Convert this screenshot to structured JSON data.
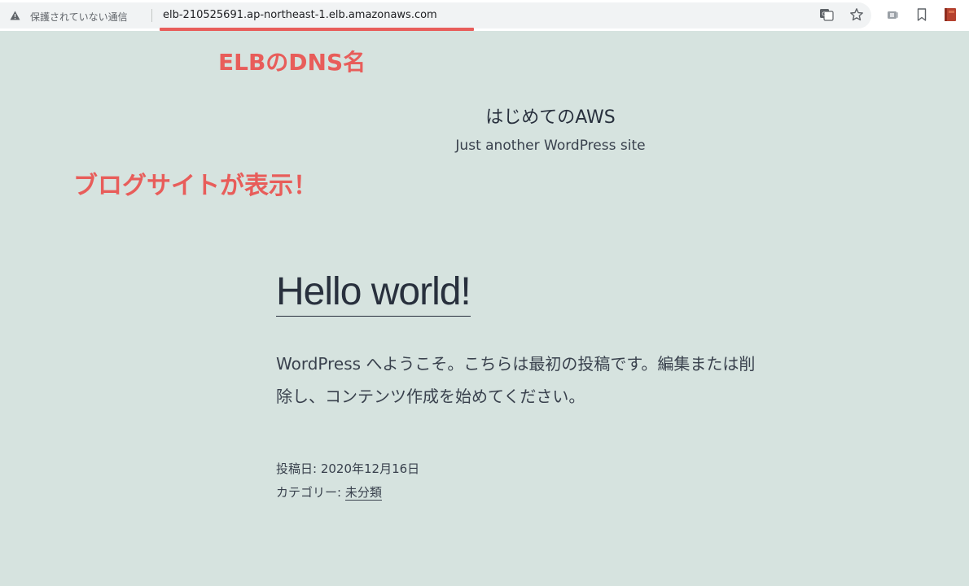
{
  "browser": {
    "security_label": "保護されていない通信",
    "url": "elb-210525691.ap-northeast-1.elb.amazonaws.com",
    "icons": [
      "warning-icon",
      "translate-icon",
      "star-icon",
      "extension-icon",
      "bookmark-icon",
      "profile-icon"
    ]
  },
  "annotations": {
    "elb": "ELBのDNS名",
    "blog": "ブログサイトが表示！",
    "color": "#e85d5a"
  },
  "site": {
    "title": "はじめてのAWS",
    "description": "Just another WordPress site",
    "background": "#d6e3df"
  },
  "post": {
    "title": "Hello world!",
    "body_line1": "WordPress へようこそ。こちらは最初の投稿です。編集または削",
    "body_line2": "除し、コンテンツ作成を始めてください。",
    "posted_on_label": "投稿日: ",
    "posted_on": "2020年12月16日",
    "category_label": "カテゴリー: ",
    "category": "未分類"
  }
}
